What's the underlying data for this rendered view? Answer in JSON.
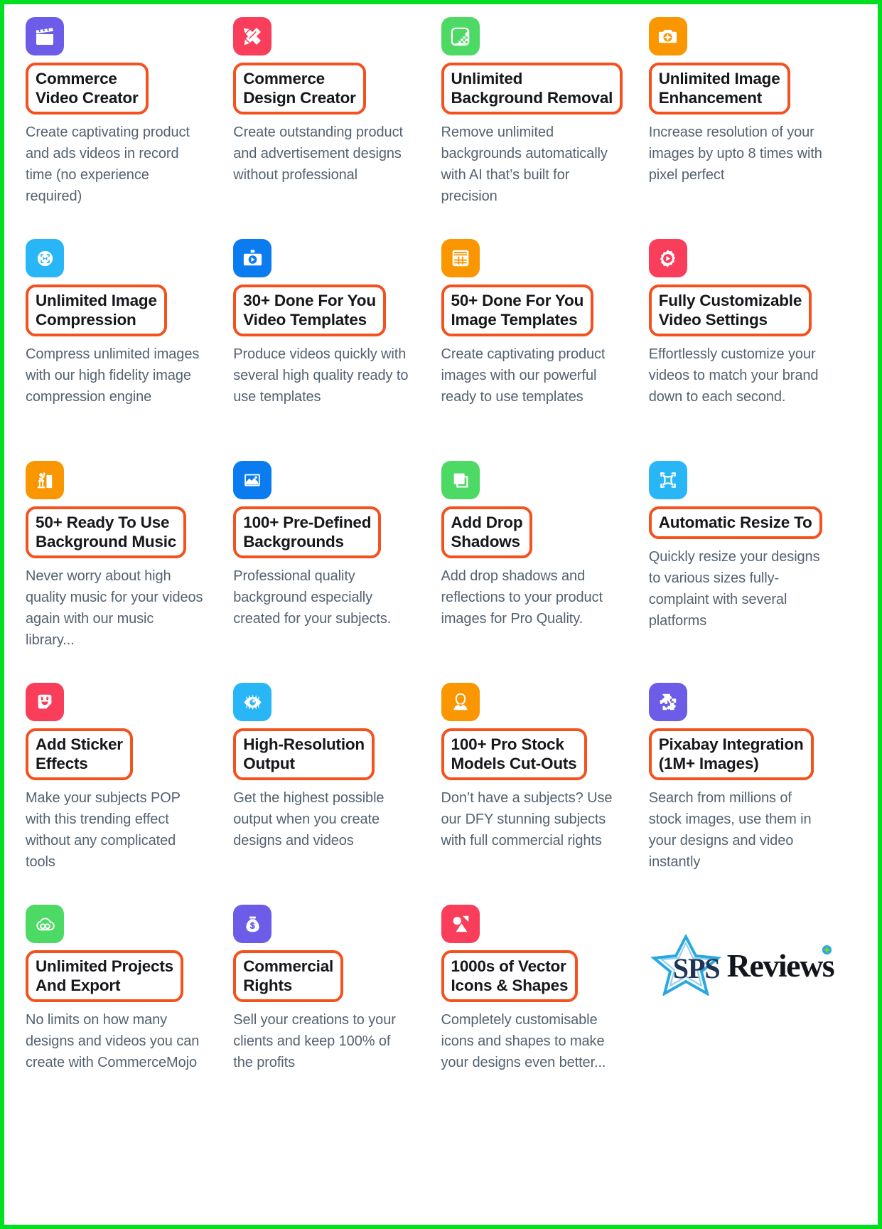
{
  "page": {
    "border_color": "#00e020",
    "title_border_color": "#f4511e",
    "background": "#ffffff",
    "body_text_color": "#546270",
    "heading_text_color": "#15171a"
  },
  "features": [
    {
      "icon": "clapperboard-icon",
      "icon_bg": "#6c5ce7",
      "title": "Commerce\nVideo Creator",
      "desc": "Create captivating product and ads videos in record time (no experience required)"
    },
    {
      "icon": "ruler-pencil-icon",
      "icon_bg": "#f83e5a",
      "title": "Unlimited\nBackground Removal",
      "title_override": "Commerce\nDesign Creator",
      "desc": "Create outstanding product and advertisement designs without professional"
    },
    {
      "icon": "background-removal-icon",
      "icon_bg": "#4cd964",
      "title": "Unlimited\nBackground Removal",
      "desc": "Remove unlimited backgrounds automatically with AI that’s built for precision"
    },
    {
      "icon": "camera-enhance-icon",
      "icon_bg": "#fa9600",
      "title": "Unlimited Image\nEnhancement",
      "desc": "Increase resolution of your images by upto 8 times with pixel perfect"
    },
    {
      "icon": "compress-arrows-icon",
      "icon_bg": "#29b6f6",
      "title": "Unlimited Image\nCompression",
      "desc": "Compress unlimited images with our high fidelity image compression engine"
    },
    {
      "icon": "video-camera-play-icon",
      "icon_bg": "#0a7cf0",
      "title": "30+ Done For You\nVideo Templates",
      "desc": "Produce videos quickly with several high quality ready to use templates"
    },
    {
      "icon": "grid-templates-icon",
      "icon_bg": "#fa9600",
      "title": "50+ Done For You\nImage Templates",
      "desc": "Create captivating product images with our powerful ready to use templates"
    },
    {
      "icon": "gear-play-icon",
      "icon_bg": "#f83e5a",
      "title": "Fully Customizable\nVideo Settings",
      "desc": "Effortlessly customize your videos to match your brand down to each second."
    },
    {
      "icon": "piano-music-icon",
      "icon_bg": "#fa9600",
      "title": "50+ Ready To Use\nBackground Music",
      "desc": "Never worry about high quality music for your videos again with our music library..."
    },
    {
      "icon": "picture-landscape-icon",
      "icon_bg": "#0a7cf0",
      "title": "100+ Pre-Defined\nBackgrounds",
      "desc": "Professional quality background especially created for your subjects."
    },
    {
      "icon": "drop-shadow-icon",
      "icon_bg": "#4cd964",
      "title": "Add Drop\nShadows",
      "desc": "Add drop shadows and reflections to your product images for Pro Quality."
    },
    {
      "icon": "resize-arrows-icon",
      "icon_bg": "#29b6f6",
      "title": "Automatic Resize To",
      "desc": "Quickly resize your designs to various sizes fully-complaint with several platforms"
    },
    {
      "icon": "sticker-smile-icon",
      "icon_bg": "#f83e5a",
      "title": "Add Sticker\nEffects",
      "desc": "Make your subjects POP with this trending effect without any complicated tools"
    },
    {
      "icon": "eye-resolution-icon",
      "icon_bg": "#29b6f6",
      "title": "High-Resolution\nOutput",
      "desc": "Get the highest possible output when you create designs and videos"
    },
    {
      "icon": "person-model-icon",
      "icon_bg": "#fa9600",
      "title": "100+ Pro Stock\nModels Cut-Outs",
      "desc": "Don’t have a subjects? Use our DFY stunning subjects with full commercial rights"
    },
    {
      "icon": "puzzle-pieces-icon",
      "icon_bg": "#6c5ce7",
      "title": "Pixabay Integration\n(1M+ Images)",
      "desc": "Search from millions of stock images, use them in your designs and video instantly"
    },
    {
      "icon": "infinity-cloud-icon",
      "icon_bg": "#4cd964",
      "title": "Unlimited Projects\nAnd Export",
      "desc": "No limits on how many designs and videos you can create with CommerceMojo"
    },
    {
      "icon": "money-bag-icon",
      "icon_bg": "#6c5ce7",
      "title": "Commercial\nRights",
      "desc": "Sell your creations to your clients and keep 100% of the profits"
    },
    {
      "icon": "vector-shapes-icon",
      "icon_bg": "#f83e5a",
      "title": "1000s of Vector\nIcons & Shapes",
      "desc": "Completely customisable icons and shapes to make your designs even better..."
    }
  ],
  "logo": {
    "sps": "SPS",
    "reviews": "Reviews",
    "star_color": "#29a8e0",
    "sps_color": "#1f3356",
    "reviews_color": "#12161c"
  }
}
